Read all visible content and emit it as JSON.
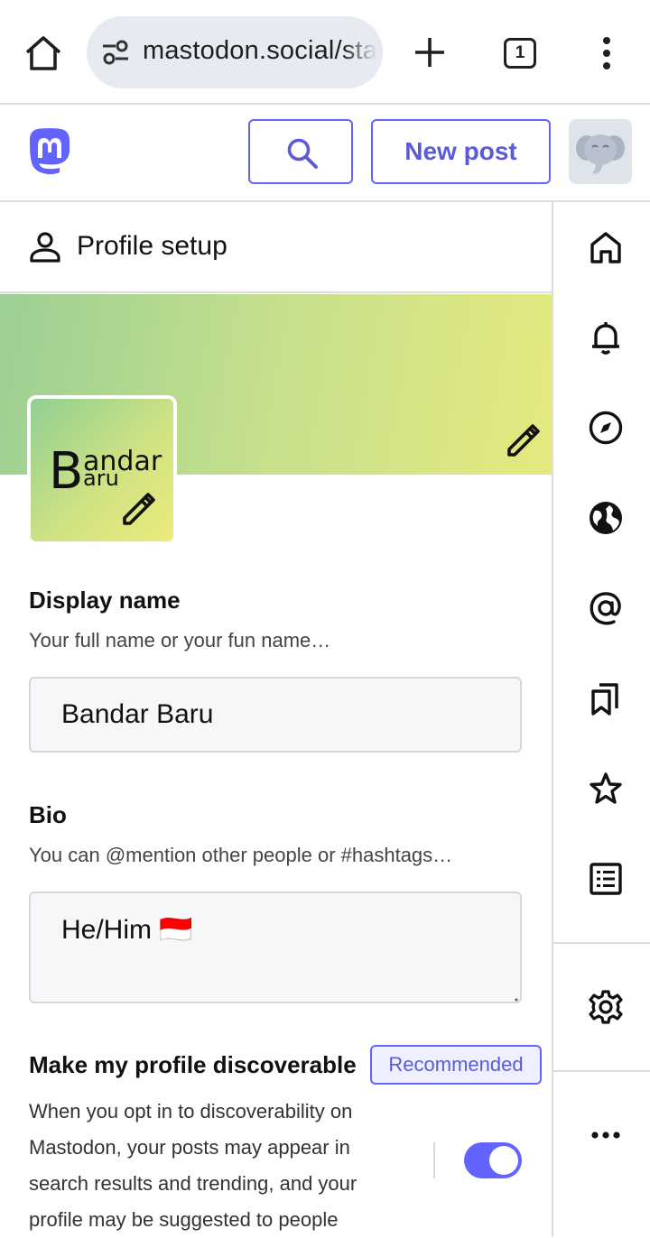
{
  "browser": {
    "url": "mastodon.social/start/profile",
    "tab_count": "1"
  },
  "header": {
    "new_post_label": "New post"
  },
  "column": {
    "title": "Profile setup"
  },
  "avatar_card": {
    "big_letter": "B",
    "line1": "andar",
    "line2": "aru"
  },
  "display_name": {
    "label": "Display name",
    "hint": "Your full name or your fun name…",
    "value": "Bandar Baru"
  },
  "bio": {
    "label": "Bio",
    "hint": "You can @mention other people or #hashtags…",
    "value": "He/Him 🇮🇩"
  },
  "discoverable": {
    "label": "Make my profile discoverable",
    "badge": "Recommended",
    "description": "When you opt in to discoverability on Mastodon, your posts may appear in search results and trending, and your profile may be suggested to people",
    "enabled": true
  },
  "colors": {
    "accent": "#6364ff",
    "accent_text": "#5a5bd6",
    "mastodon_logo": "#6364ff"
  },
  "rail": {
    "icons": [
      "home-icon",
      "notifications-bell-icon",
      "explore-compass-icon",
      "globe-icon",
      "mentions-at-icon",
      "bookmarks-icon",
      "favourites-star-icon",
      "lists-icon",
      "settings-gear-icon",
      "more-dots-icon"
    ]
  }
}
